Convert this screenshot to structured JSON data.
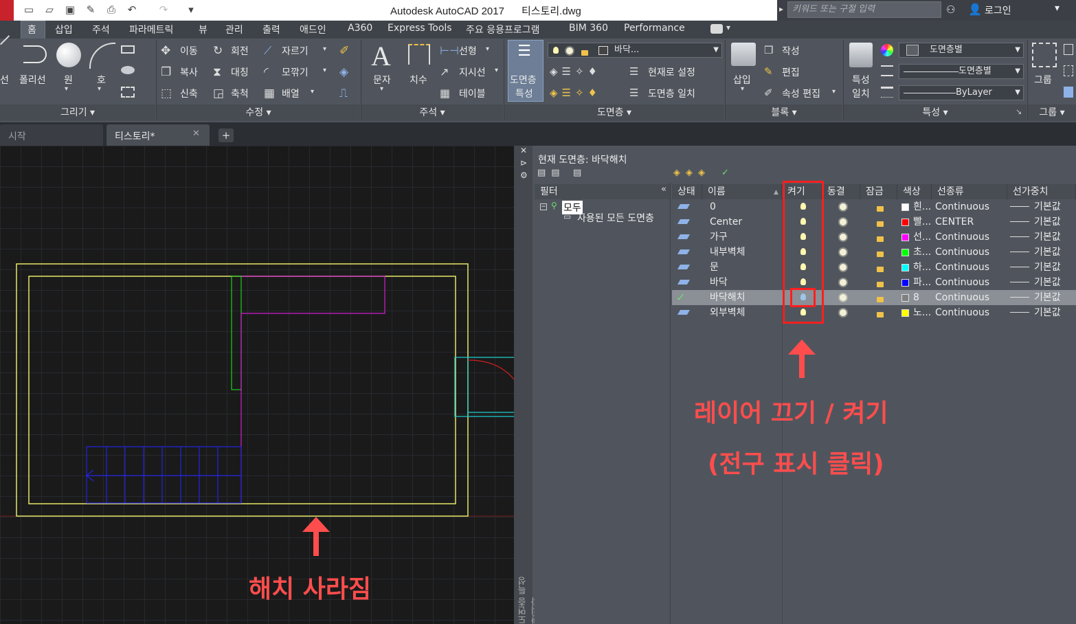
{
  "window": {
    "title": "Autodesk AutoCAD 2017",
    "doc_name": "티스토리.dwg",
    "search_placeholder": "키워드 또는 구절 입력",
    "login": "로그인"
  },
  "ribbon_tabs": [
    "홈",
    "삽입",
    "주석",
    "파라메트릭",
    "뷰",
    "관리",
    "출력",
    "애드인",
    "A360",
    "Express Tools",
    "주요 응용프로그램",
    "BIM 360",
    "Performance"
  ],
  "draw_panel": {
    "title": "그리기",
    "polyline": "폴리선",
    "circle": "원",
    "arc": "호",
    "line_partial": "선"
  },
  "modify_panel": {
    "title": "수정",
    "move": "이동",
    "rotate": "회전",
    "trim": "자르기",
    "copy": "복사",
    "mirror": "대칭",
    "fillet": "모깎기",
    "stretch": "신축",
    "scale": "축척",
    "array": "배열"
  },
  "annotation_panel": {
    "title": "주석",
    "text": "문자",
    "dimension": "치수",
    "linear": "선형",
    "leader": "지시선",
    "table": "테이블"
  },
  "layer_panel": {
    "title": "도면층",
    "props_btn_line1": "도면층",
    "props_btn_line2": "특성",
    "layer_dropdown": "바닥...",
    "make_current": "현재로 설정",
    "match": "도면층 일치"
  },
  "block_panel": {
    "title": "블록",
    "insert": "삽입",
    "create": "작성",
    "edit": "편집",
    "edit_attr": "속성 편집"
  },
  "properties_panel": {
    "title": "특성",
    "match_line1": "특성",
    "match_line2": "일치",
    "color": "도면층별",
    "linetype": "도면층별",
    "lineweight": "ByLayer"
  },
  "group_panel": {
    "title": "그룹",
    "group": "그룹"
  },
  "doc_tabs": [
    "시작",
    "티스토리*"
  ],
  "layer_manager": {
    "current_layer_label": "현재 도면층: 바닥해치",
    "filter_header": "필터",
    "tree": {
      "root": "모두",
      "child": "사용된 모든 도면층"
    },
    "columns": [
      "상태",
      "이름",
      "켜기",
      "동결",
      "잠금",
      "색상",
      "선종류",
      "선가중치"
    ],
    "rows": [
      {
        "name": "0",
        "color_label": "흰...",
        "color": "#ffffff",
        "linetype": "Continuous",
        "lineweight": "기본값",
        "current": false,
        "on": true
      },
      {
        "name": "Center",
        "color_label": "빨...",
        "color": "#ff0000",
        "linetype": "CENTER",
        "lineweight": "기본값",
        "current": false,
        "on": true
      },
      {
        "name": "가구",
        "color_label": "선...",
        "color": "#ff00ff",
        "linetype": "Continuous",
        "lineweight": "기본값",
        "current": false,
        "on": true
      },
      {
        "name": "내부벽체",
        "color_label": "초...",
        "color": "#00ff00",
        "linetype": "Continuous",
        "lineweight": "기본값",
        "current": false,
        "on": true
      },
      {
        "name": "문",
        "color_label": "하...",
        "color": "#00ffff",
        "linetype": "Continuous",
        "lineweight": "기본값",
        "current": false,
        "on": true
      },
      {
        "name": "바닥",
        "color_label": "파...",
        "color": "#0000ff",
        "linetype": "Continuous",
        "lineweight": "기본값",
        "current": false,
        "on": true
      },
      {
        "name": "바닥해치",
        "color_label": "8",
        "color": "#808080",
        "linetype": "Continuous",
        "lineweight": "기본값",
        "current": true,
        "on": false
      },
      {
        "name": "외부벽체",
        "color_label": "노...",
        "color": "#ffff00",
        "linetype": "Continuous",
        "lineweight": "기본값",
        "current": false,
        "on": true
      }
    ],
    "side_label": "도면층 특성 관리자"
  },
  "annotations": {
    "onoff": "레이어 끄기 / 켜기",
    "onoff_sub": "(전구 표시 클릭)",
    "hatch": "해치 사라짐"
  },
  "colors": {
    "annotation": "#ff4d4d",
    "ribbon_bg": "#50555d",
    "drawing_bg": "#1a1a1a"
  }
}
